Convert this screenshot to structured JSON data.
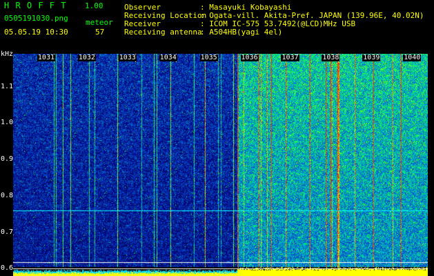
{
  "app": {
    "logo": "H R O F F T",
    "version": "1.00"
  },
  "file": {
    "name": "0505191030.png",
    "datetime": "05.05.19 10:30"
  },
  "meteor": {
    "label": "meteor",
    "count": "57"
  },
  "info": [
    {
      "key": "Observer",
      "value": ": Masayuki Kobayashi"
    },
    {
      "key": "Receiving Location",
      "value": ": Ogata-vill. Akita-Pref. JAPAN (139.96E, 40.02N)"
    },
    {
      "key": "Receiver",
      "value": ": ICOM IC-575 53.7492(@LCD)MHz USB"
    },
    {
      "key": "Receiving antenna",
      "value": ": A504HB(yagi 4el)"
    }
  ],
  "chart_data": {
    "type": "heatmap",
    "ylabel": "kHz",
    "y_ticks": [
      "1.1",
      "1.0",
      "0.9",
      "0.8",
      "0.7",
      "0.6"
    ],
    "ylim": [
      0.58,
      1.19
    ],
    "x_ticks": [
      "1031",
      "1032",
      "1033",
      "1034",
      "1035",
      "1036",
      "1037",
      "1038",
      "1039",
      "1040"
    ],
    "xlim": [
      1030,
      1040.2
    ],
    "noise_level_change_minute": 1035.5,
    "colors": {
      "low": "#0a1a6e",
      "mid": "#00aaff",
      "high": "#40ff40",
      "peak": "#ff3000",
      "baseline": "#ffff00",
      "scale": "#00ffff"
    }
  }
}
